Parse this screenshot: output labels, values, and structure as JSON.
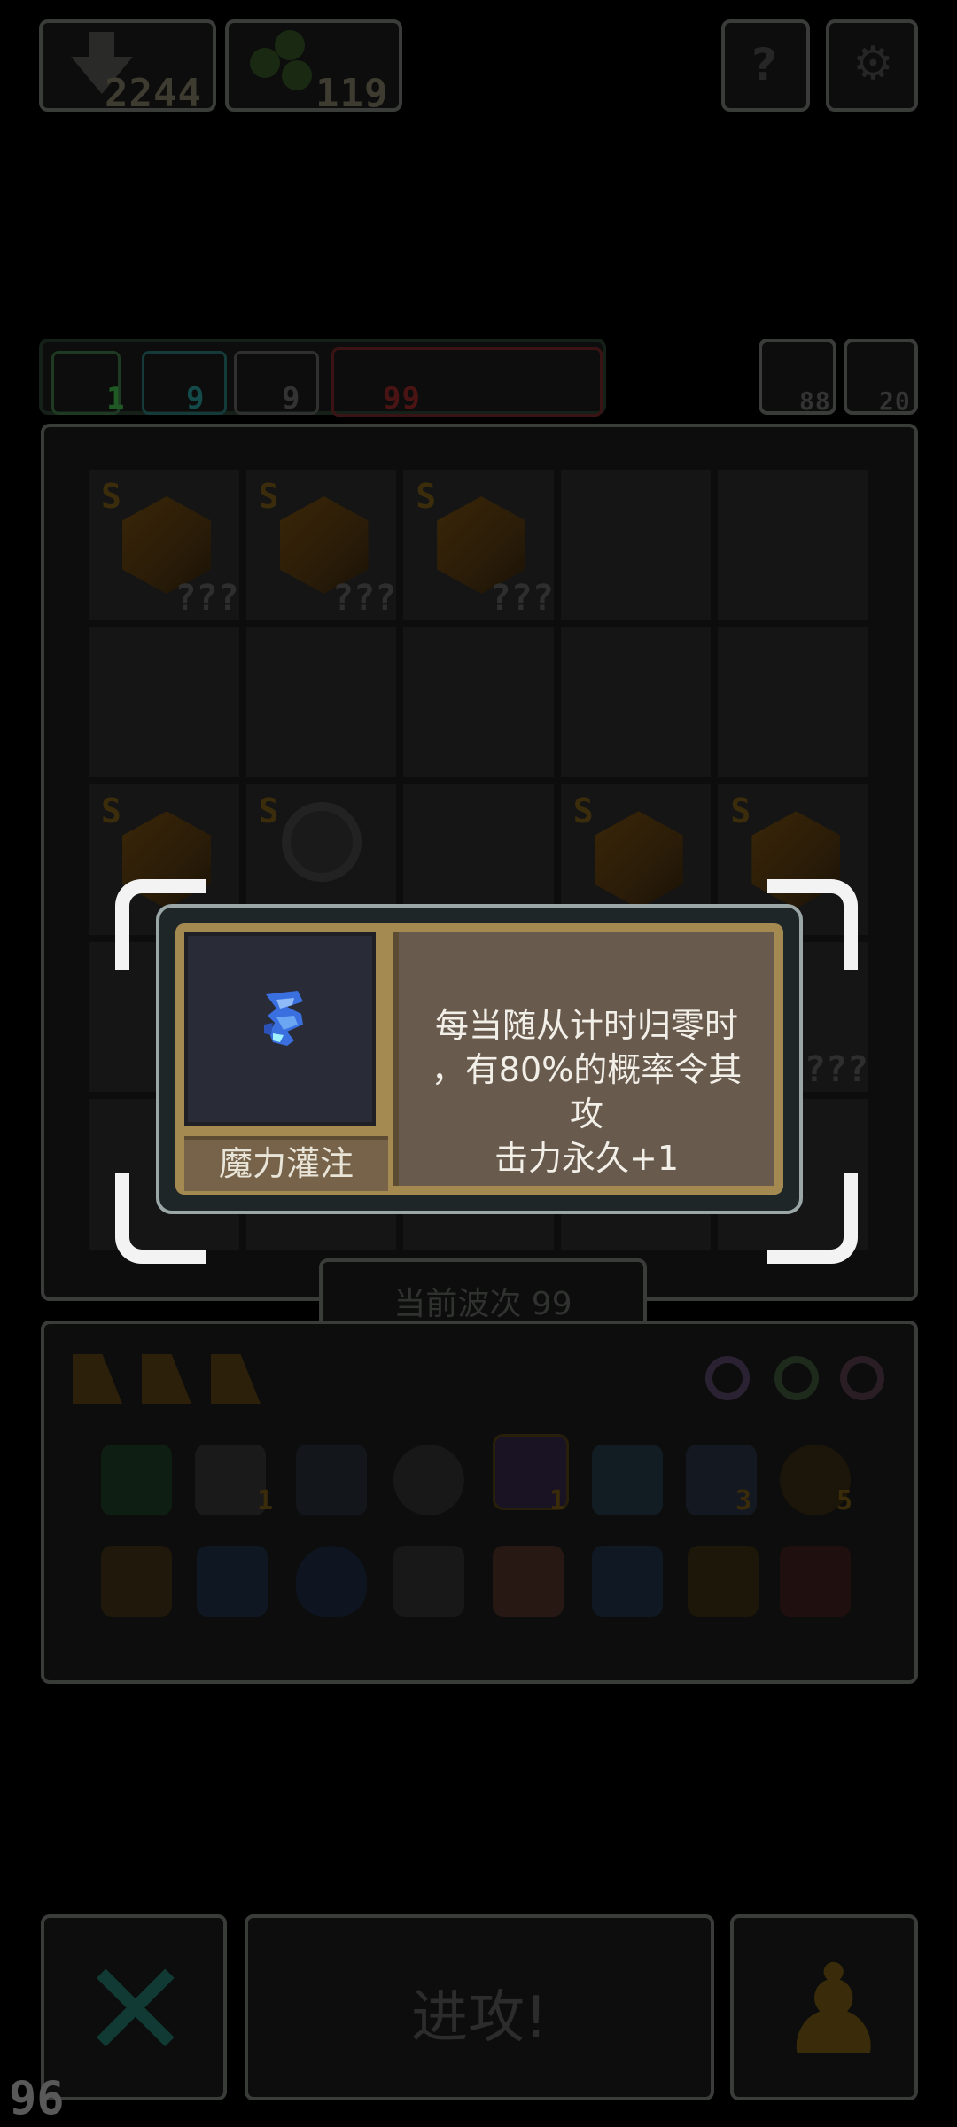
{
  "hud": {
    "currency_a": "2244",
    "currency_b": "119",
    "top_buttons": [
      "help-icon",
      "settings-icon"
    ]
  },
  "stats": {
    "green": "1",
    "cyan": "9",
    "sword": "9",
    "red": "99",
    "up": "88",
    "key": "20"
  },
  "grid": {
    "cells": [
      {
        "rank": "S",
        "label": "???"
      },
      {
        "rank": "S",
        "label": "???"
      },
      {
        "rank": "S",
        "label": "???"
      },
      {
        "rank": "",
        "label": ""
      },
      {
        "rank": "",
        "label": ""
      },
      {
        "rank": "",
        "label": ""
      },
      {
        "rank": "",
        "label": ""
      },
      {
        "rank": "",
        "label": ""
      },
      {
        "rank": "",
        "label": ""
      },
      {
        "rank": "",
        "label": ""
      },
      {
        "rank": "S",
        "label": "???"
      },
      {
        "rank": "S",
        "label": "???"
      },
      {
        "rank": "",
        "label": ""
      },
      {
        "rank": "S",
        "label": "???"
      },
      {
        "rank": "S",
        "label": "???"
      },
      {
        "rank": "",
        "label": ""
      },
      {
        "rank": "",
        "label": ""
      },
      {
        "rank": "",
        "label": ""
      },
      {
        "rank": "",
        "label": ""
      },
      {
        "rank": "",
        "label": "???"
      },
      {
        "rank": "",
        "label": ""
      },
      {
        "rank": "",
        "label": ""
      },
      {
        "rank": "",
        "label": ""
      },
      {
        "rank": "",
        "label": ""
      },
      {
        "rank": "",
        "label": ""
      }
    ]
  },
  "wave": {
    "label": "当前波次 99"
  },
  "inventory": {
    "counts": [
      "1",
      "1",
      "3",
      "5"
    ]
  },
  "buttons": {
    "attack": "进攻!"
  },
  "fps": "96",
  "popup": {
    "name": "魔力灌注",
    "description": [
      "每当随从计时归零时",
      "，有80%的概率令其攻",
      "击力永久+1"
    ]
  },
  "colors": {
    "popup_frame": "#9aa7a6",
    "popup_gold": "#a48a51",
    "desc_bg": "#685a4c"
  }
}
